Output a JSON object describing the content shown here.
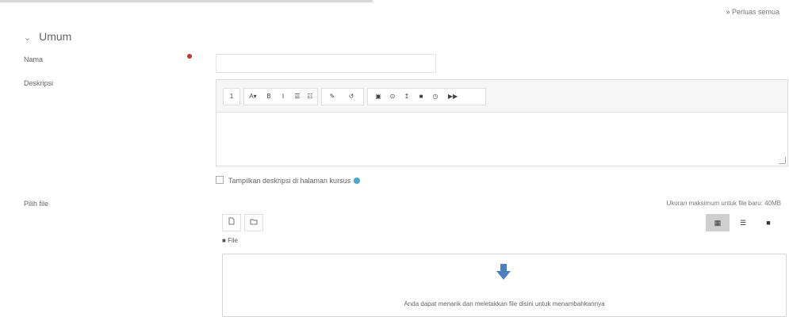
{
  "header": {
    "expand_all": "» Perluas semua"
  },
  "section": {
    "title": "Umum",
    "chevron": "chevron-down-icon"
  },
  "form": {
    "name_label": "Nama",
    "name_value": "",
    "description_label": "Deskripsi",
    "show_description": "Tampilkan deskripsi di halaman kursus",
    "files_label": "Pilih file",
    "max_size": "Ukuran maksimum untuk file baru: 40MB"
  },
  "toolbar": {
    "buttons": [
      "1",
      "A▾",
      "B",
      "I",
      "☰",
      "☷",
      "✎",
      "↺",
      "▣",
      "⊙",
      "↥",
      "■",
      "◷",
      "▶▶"
    ]
  },
  "filepicker": {
    "path_label": "File",
    "drop_text": "Anda dapat menarik dan meletakkan file disini untuk menambahkannya"
  },
  "colors": {
    "required": "#c0392b",
    "help": "#4aa7c9",
    "arrow": "#4a7fc1"
  }
}
